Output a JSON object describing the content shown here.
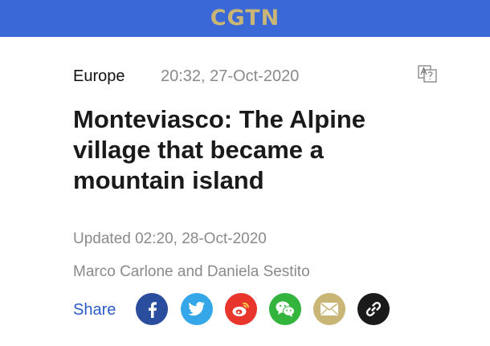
{
  "header": {
    "logo_text": "CGTN",
    "background_color": "#3a68d6",
    "logo_color": "#c9b676"
  },
  "article": {
    "category": "Europe",
    "published": "20:32, 27-Oct-2020",
    "title": "Monteviasco: The Alpine village that became a mountain island",
    "updated": "Updated 02:20, 28-Oct-2020",
    "authors": "Marco Carlone and Daniela Sestito",
    "translate_icon": "translate-icon"
  },
  "share": {
    "label": "Share",
    "buttons": [
      {
        "name": "facebook",
        "icon": "facebook-icon",
        "color": "#2a4d9e"
      },
      {
        "name": "twitter",
        "icon": "twitter-icon",
        "color": "#35a7e8"
      },
      {
        "name": "weibo",
        "icon": "weibo-icon",
        "color": "#e8362d"
      },
      {
        "name": "wechat",
        "icon": "wechat-icon",
        "color": "#33b43c"
      },
      {
        "name": "email",
        "icon": "email-icon",
        "color": "#c9b676"
      },
      {
        "name": "link",
        "icon": "link-icon",
        "color": "#1a1a1a"
      }
    ]
  }
}
